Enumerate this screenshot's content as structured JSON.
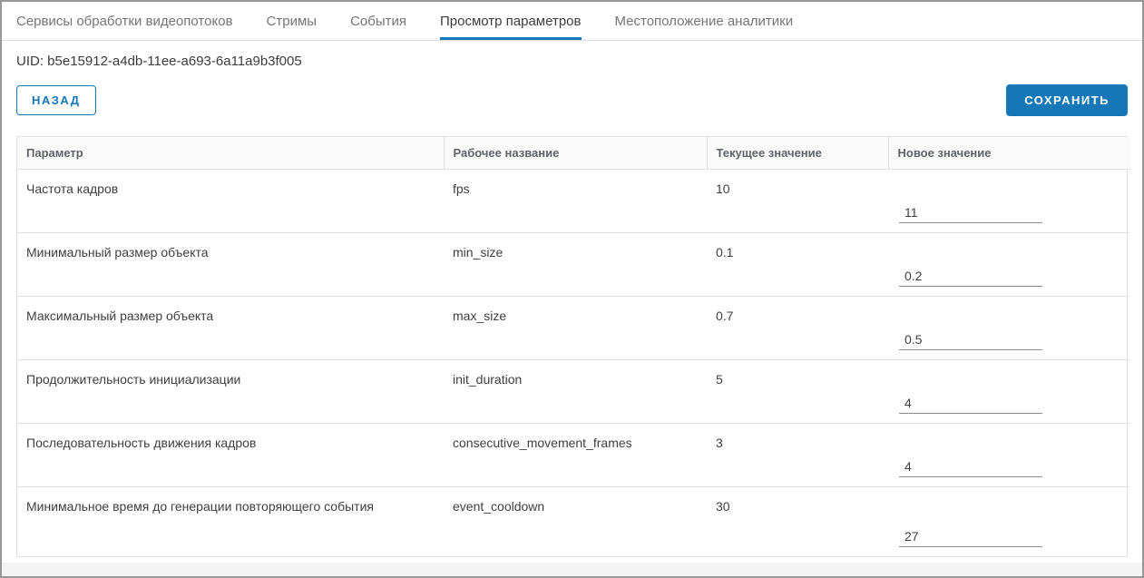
{
  "tabs": {
    "items": [
      {
        "label": "Сервисы обработки видеопотоков",
        "active": false
      },
      {
        "label": "Стримы",
        "active": false
      },
      {
        "label": "События",
        "active": false
      },
      {
        "label": "Просмотр параметров",
        "active": true
      },
      {
        "label": "Местоположение аналитики",
        "active": false
      }
    ]
  },
  "uid": {
    "text": "UID: b5e15912-a4db-11ee-a693-6a11a9b3f005"
  },
  "buttons": {
    "back": "НАЗАД",
    "save": "СОХРАНИТЬ"
  },
  "table": {
    "headers": [
      "Параметр",
      "Рабочее название",
      "Текущее значение",
      "Новое значение"
    ],
    "rows": [
      {
        "param": "Частота кадров",
        "working_name": "fps",
        "current_value": "10",
        "new_value": "11"
      },
      {
        "param": "Минимальный размер объекта",
        "working_name": "min_size",
        "current_value": "0.1",
        "new_value": "0.2"
      },
      {
        "param": "Максимальный размер объекта",
        "working_name": "max_size",
        "current_value": "0.7",
        "new_value": "0.5"
      },
      {
        "param": "Продолжительность инициализации",
        "working_name": "init_duration",
        "current_value": "5",
        "new_value": "4"
      },
      {
        "param": "Последовательность движения кадров",
        "working_name": "consecutive_movement_frames",
        "current_value": "3",
        "new_value": "4"
      },
      {
        "param": "Минимальное время до генерации повторяющего события",
        "working_name": "event_cooldown",
        "current_value": "30",
        "new_value": "27"
      }
    ]
  },
  "colors": {
    "accent_blue": "#1478b8",
    "tab_inactive_text": "#757575",
    "active_tab_text": "#3d3d3d",
    "table_border": "#e0e0e0",
    "header_background": "#fafafa",
    "outer_border": "#979797"
  }
}
